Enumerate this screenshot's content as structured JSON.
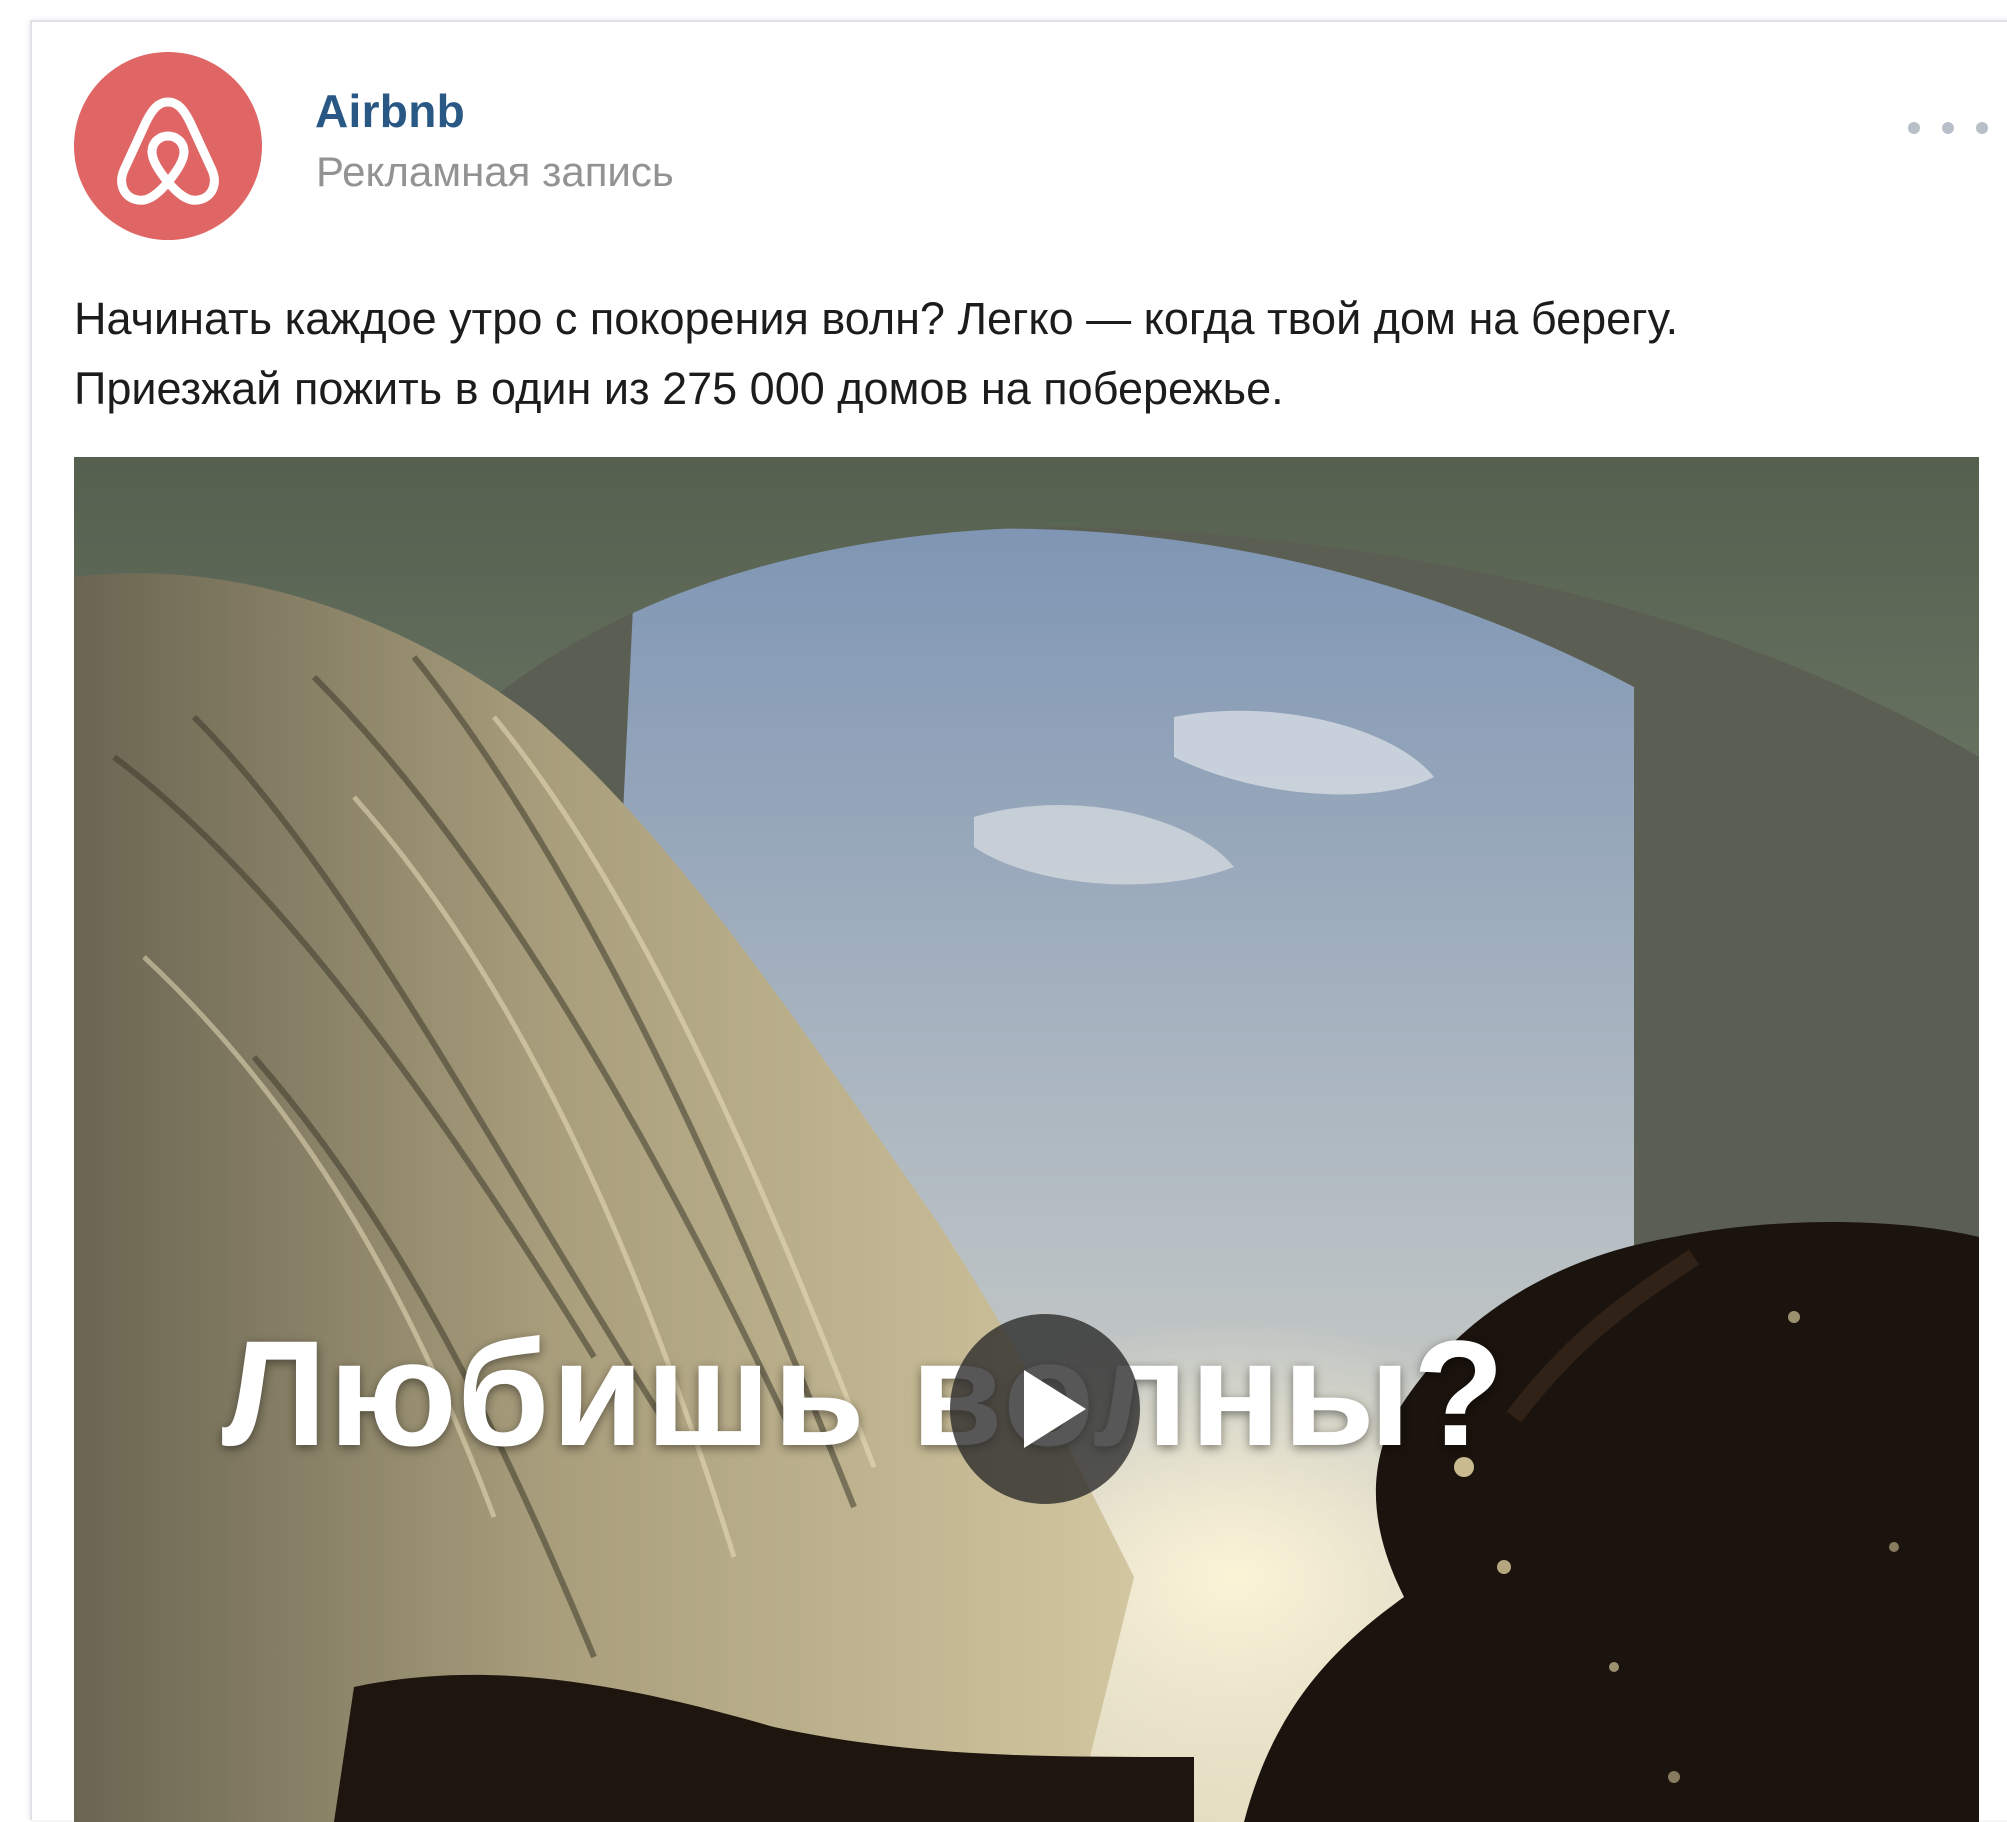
{
  "post": {
    "author": "Airbnb",
    "subtitle": "Рекламная запись",
    "text_lines": [
      "Начинать каждое утро с покорения волн? Легко — когда твой дом на берегу.",
      "Приезжай пожить в один из 275 000 домов на побережье."
    ],
    "avatar_icon": "airbnb-logo-icon",
    "more_icon": "more-dots-icon"
  },
  "media": {
    "overlay_text": "Любишь волны?",
    "play_icon": "play-icon"
  },
  "colors": {
    "brand": "#e06665",
    "author_link": "#2a5885",
    "subtitle": "#939393",
    "text": "#1c1c1c"
  }
}
